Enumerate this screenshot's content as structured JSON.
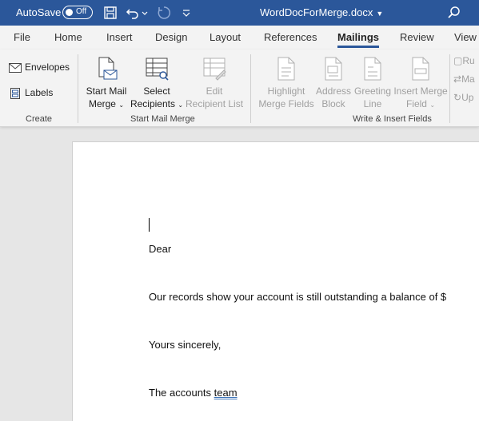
{
  "titlebar": {
    "autosave_label": "AutoSave",
    "autosave_state": "Off",
    "doc_title": "WordDocForMerge.docx"
  },
  "tabs": [
    {
      "label": "File"
    },
    {
      "label": "Home"
    },
    {
      "label": "Insert"
    },
    {
      "label": "Design"
    },
    {
      "label": "Layout"
    },
    {
      "label": "References"
    },
    {
      "label": "Mailings",
      "active": true
    },
    {
      "label": "Review"
    },
    {
      "label": "View"
    }
  ],
  "ribbon": {
    "create": {
      "envelopes": "Envelopes",
      "labels": "Labels",
      "group_label": "Create"
    },
    "start_mail_merge": {
      "start_line1": "Start Mail",
      "start_line2": "Merge",
      "select_line1": "Select",
      "select_line2": "Recipients",
      "edit_line1": "Edit",
      "edit_line2": "Recipient List",
      "group_label": "Start Mail Merge"
    },
    "write_insert": {
      "highlight_line1": "Highlight",
      "highlight_line2": "Merge Fields",
      "address_line1": "Address",
      "address_line2": "Block",
      "greeting_line1": "Greeting",
      "greeting_line2": "Line",
      "insert_line1": "Insert Merge",
      "insert_line2": "Field",
      "group_label": "Write & Insert Fields"
    },
    "right_items": [
      "Ru",
      "Ma",
      "Up"
    ]
  },
  "document": {
    "paragraphs": [
      "Dear",
      "Our records show your account is still outstanding a balance of $",
      "Yours sincerely,",
      "The accounts"
    ],
    "last_word": "team"
  },
  "colors": {
    "titlebar": "#2b579a",
    "ribbon": "#f3f3f3",
    "canvas": "#e6e6e6"
  }
}
